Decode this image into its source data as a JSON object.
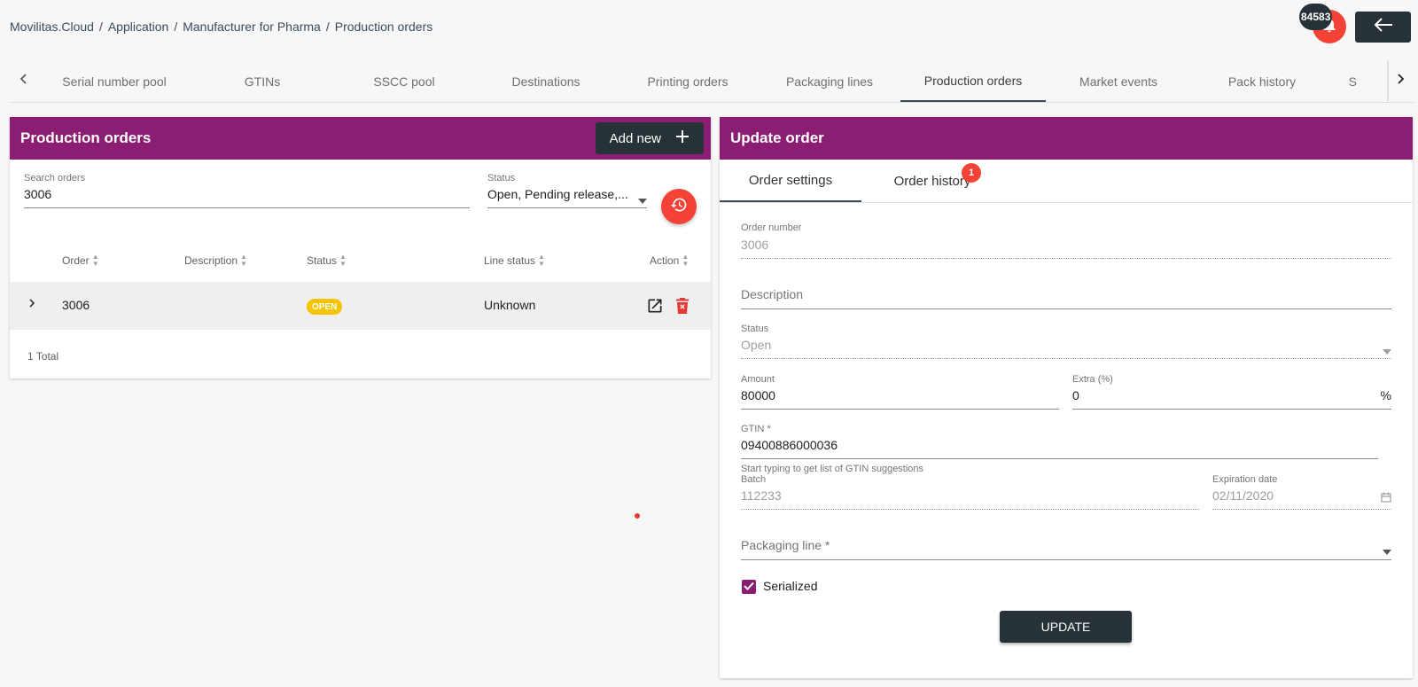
{
  "breadcrumb": [
    "Movilitas.Cloud",
    "Application",
    "Manufacturer for Pharma",
    "Production orders"
  ],
  "notifications": {
    "count": "84583"
  },
  "nav_tabs": [
    "Serial number pool",
    "GTINs",
    "SSCC pool",
    "Destinations",
    "Printing orders",
    "Packaging lines",
    "Production orders",
    "Market events",
    "Pack history",
    "S"
  ],
  "active_tab": "Production orders",
  "left_panel": {
    "title": "Production orders",
    "add_new_label": "Add new",
    "search": {
      "label": "Search orders",
      "value": "3006"
    },
    "status_filter": {
      "label": "Status",
      "value": "Open, Pending release,..."
    },
    "columns": [
      "Order",
      "Description",
      "Status",
      "Line status",
      "Action"
    ],
    "rows": [
      {
        "order": "3006",
        "description": "",
        "status": "OPEN",
        "line_status": "Unknown"
      }
    ],
    "total": "1 Total"
  },
  "right_panel": {
    "title": "Update order",
    "tabs": [
      "Order settings",
      "Order history"
    ],
    "history_badge": "1",
    "order_number": {
      "label": "Order number",
      "value": "3006"
    },
    "description": {
      "placeholder": "Description"
    },
    "status": {
      "label": "Status",
      "value": "Open"
    },
    "amount": {
      "label": "Amount",
      "value": "80000"
    },
    "extra": {
      "label": "Extra (%)",
      "value": "0",
      "suffix": "%"
    },
    "gtin": {
      "label": "GTIN *",
      "value": "09400886000036",
      "hint": "Start typing to get list of GTIN suggestions"
    },
    "batch": {
      "label": "Batch",
      "value": "112233"
    },
    "expiration": {
      "label": "Expiration date",
      "value": "02/11/2020"
    },
    "packaging_line": {
      "placeholder": "Packaging line *"
    },
    "serialized": {
      "label": "Serialized",
      "checked": true
    },
    "update_label": "UPDATE"
  },
  "colors": {
    "brand": "#8b1e72",
    "dark": "#263238",
    "accent_red": "#f44336",
    "badge_yellow": "#f5c400"
  },
  "icons": [
    "bell-icon",
    "arrow-left-icon",
    "chevron-left-icon",
    "chevron-right-icon",
    "plus-icon",
    "history-icon",
    "open-external-icon",
    "delete-icon",
    "calendar-icon",
    "dropdown-caret-icon",
    "check-icon"
  ]
}
